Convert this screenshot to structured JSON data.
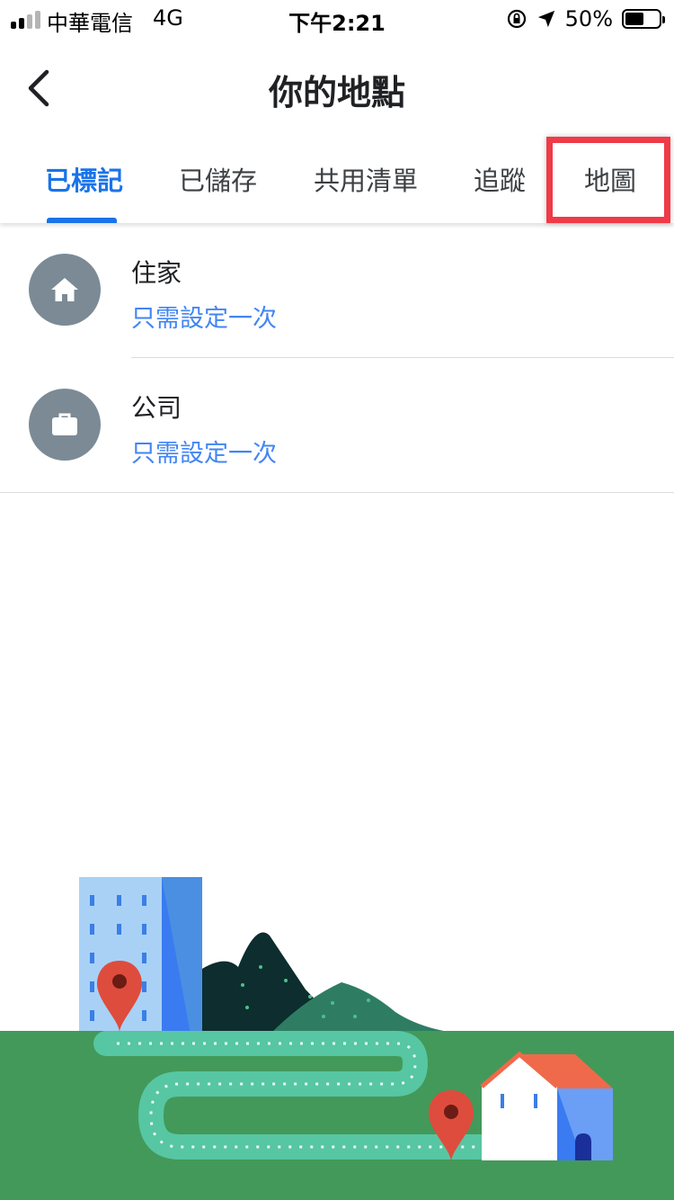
{
  "status_bar": {
    "carrier": "中華電信",
    "network": "4G",
    "time": "下午2:21",
    "battery": "50%"
  },
  "header": {
    "back_icon": "chevron-left-icon",
    "title": "你的地點"
  },
  "tabs": [
    {
      "label": "已標記",
      "active": true
    },
    {
      "label": "已儲存",
      "active": false
    },
    {
      "label": "共用清單",
      "active": false
    },
    {
      "label": "追蹤",
      "active": false
    },
    {
      "label": "地圖",
      "active": false,
      "highlighted": true
    }
  ],
  "list": [
    {
      "icon": "home-icon",
      "title": "住家",
      "subtitle": "只需設定一次"
    },
    {
      "icon": "briefcase-icon",
      "title": "公司",
      "subtitle": "只需設定一次"
    }
  ],
  "colors": {
    "accent": "#1a73e8",
    "link": "#4285f4",
    "avatar": "#7b8a95",
    "highlight": "#f03a47",
    "grass": "#43995a"
  }
}
